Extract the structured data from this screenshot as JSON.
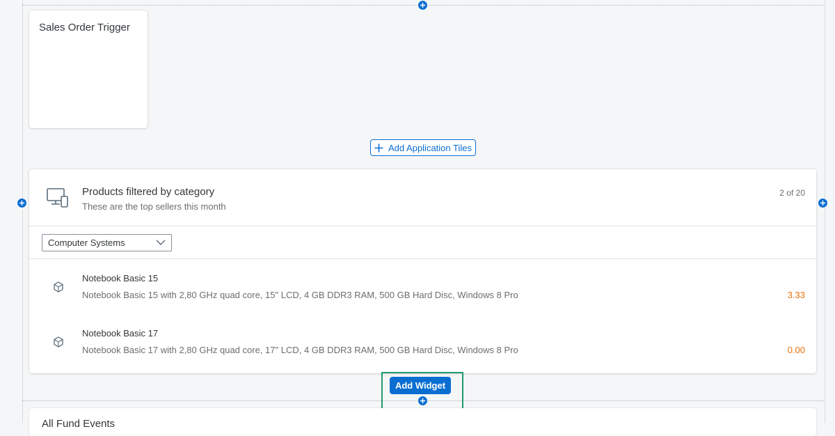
{
  "tiles_section": {
    "tile": {
      "title": "Sales Order Trigger"
    },
    "add_tiles_label": "Add Application Tiles"
  },
  "widget": {
    "title": "Products filtered by category",
    "subtitle": "These are the top sellers this month",
    "count": "2 of 20",
    "filter": {
      "selected": "Computer Systems"
    },
    "products": [
      {
        "name": "Notebook Basic 15",
        "description": "Notebook Basic 15 with 2,80 GHz quad core, 15\" LCD, 4 GB DDR3 RAM, 500 GB Hard Disc, Windows 8 Pro",
        "value": "3.33"
      },
      {
        "name": "Notebook Basic 17",
        "description": "Notebook Basic 17 with 2,80 GHz quad core, 17\" LCD, 4 GB DDR3 RAM, 500 GB Hard Disc, Windows 8 Pro",
        "value": "0.00"
      }
    ]
  },
  "add_widget_label": "Add Widget",
  "next_section": {
    "title": "All Fund Events"
  },
  "colors": {
    "accent": "#0a6ed1",
    "value": "#e9730c",
    "highlight": "#1f9a6f"
  },
  "icons": {
    "add": "plus-circle-icon",
    "device": "devices-icon",
    "product": "product-cube-icon",
    "dropdown": "chevron-down-icon"
  }
}
